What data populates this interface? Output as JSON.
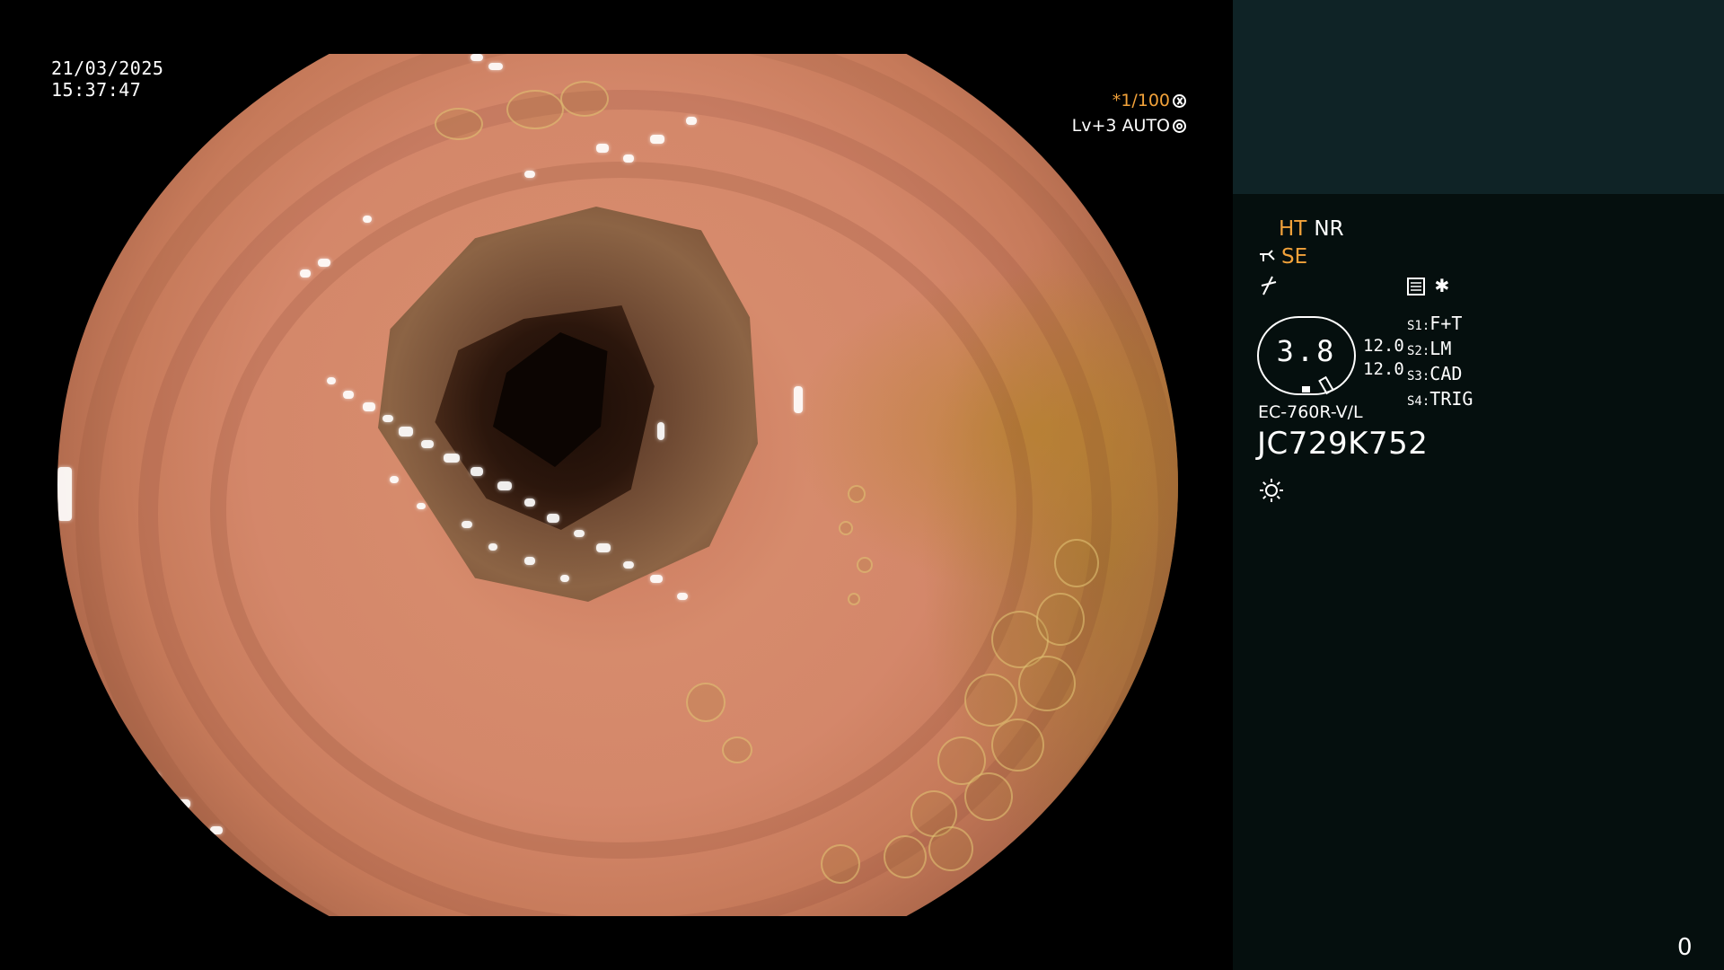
{
  "datetime": {
    "date": "21/03/2025",
    "time": "15:37:47"
  },
  "exposure": {
    "shutter": "*1/100",
    "level": "Lv+3 AUTO"
  },
  "panel": {
    "mode_ht": "HT",
    "mode_nr": "NR",
    "mode_se": "SE",
    "scale_value": "3.8",
    "scale_nums": [
      "12.0",
      "12.0"
    ],
    "switches": [
      {
        "key": "S1:",
        "value": "F+T"
      },
      {
        "key": "S2:",
        "value": "LM"
      },
      {
        "key": "S3:",
        "value": "CAD"
      },
      {
        "key": "S4:",
        "value": "TRIG"
      }
    ],
    "model": "EC-760R-V/L",
    "serial": "JC729K752",
    "counter": "0"
  },
  "colors": {
    "accent_orange": "#f2a23a",
    "panel_background": "#050f0e",
    "panel_top_background": "#0f2326"
  },
  "icons": [
    "shutter-icon",
    "auto-exposure-icon",
    "scope-icon",
    "lightning-icon",
    "document-icon",
    "star-icon",
    "sun-icon"
  ]
}
